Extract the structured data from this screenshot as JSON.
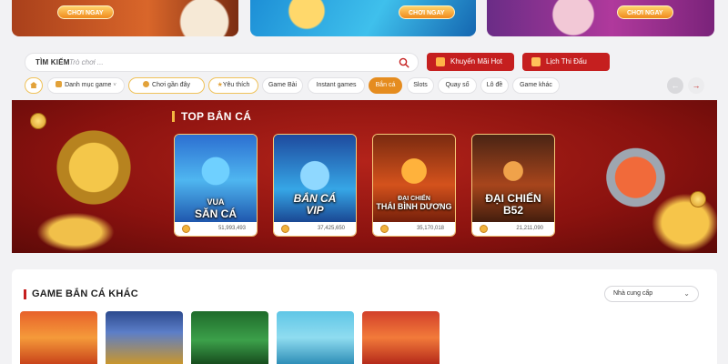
{
  "promos": [
    {
      "button": "CHƠI NGAY"
    },
    {
      "button": "CHƠI NGAY"
    },
    {
      "button": "CHƠI NGAY"
    }
  ],
  "search": {
    "label": "TÌM KIẾM",
    "placeholder": "Trò chơi ..."
  },
  "header_buttons": {
    "promo": "Khuyến Mãi Hot",
    "schedule": "Lịch Thi Đấu"
  },
  "categories": [
    {
      "label": ""
    },
    {
      "label": "Danh mục game"
    },
    {
      "label": "Chơi gần đây"
    },
    {
      "label": "Yêu thích"
    },
    {
      "label": "Game Bài"
    },
    {
      "label": "Instant games"
    },
    {
      "label": "Bắn cá"
    },
    {
      "label": "Slots"
    },
    {
      "label": "Quay số"
    },
    {
      "label": "Lô đề"
    },
    {
      "label": "Game khác"
    }
  ],
  "active_category": "Bắn cá",
  "top_section": {
    "title": "TOP BẮN CÁ",
    "games": [
      {
        "name_line1": "VUA",
        "name_line2": "SĂN CÁ",
        "count": "51,993,493"
      },
      {
        "name_line1": "BẮN CÁ",
        "name_line2": "VIP",
        "count": "37,425,650"
      },
      {
        "name_line1": "ĐẠI CHIẾN",
        "name_line2": "THÁI BÌNH DƯƠNG",
        "count": "35,170,018"
      },
      {
        "name_line1": "ĐẠI CHIẾN",
        "name_line2": "B52",
        "count": "21,211,090"
      }
    ]
  },
  "other_section": {
    "title": "GAME BẮN CÁ KHÁC",
    "filter_label": "Nhà cung cấp"
  },
  "colors": {
    "accent_red": "#c51f1f",
    "active_orange": "#e58c1f",
    "banner_red": "#8a120f"
  }
}
